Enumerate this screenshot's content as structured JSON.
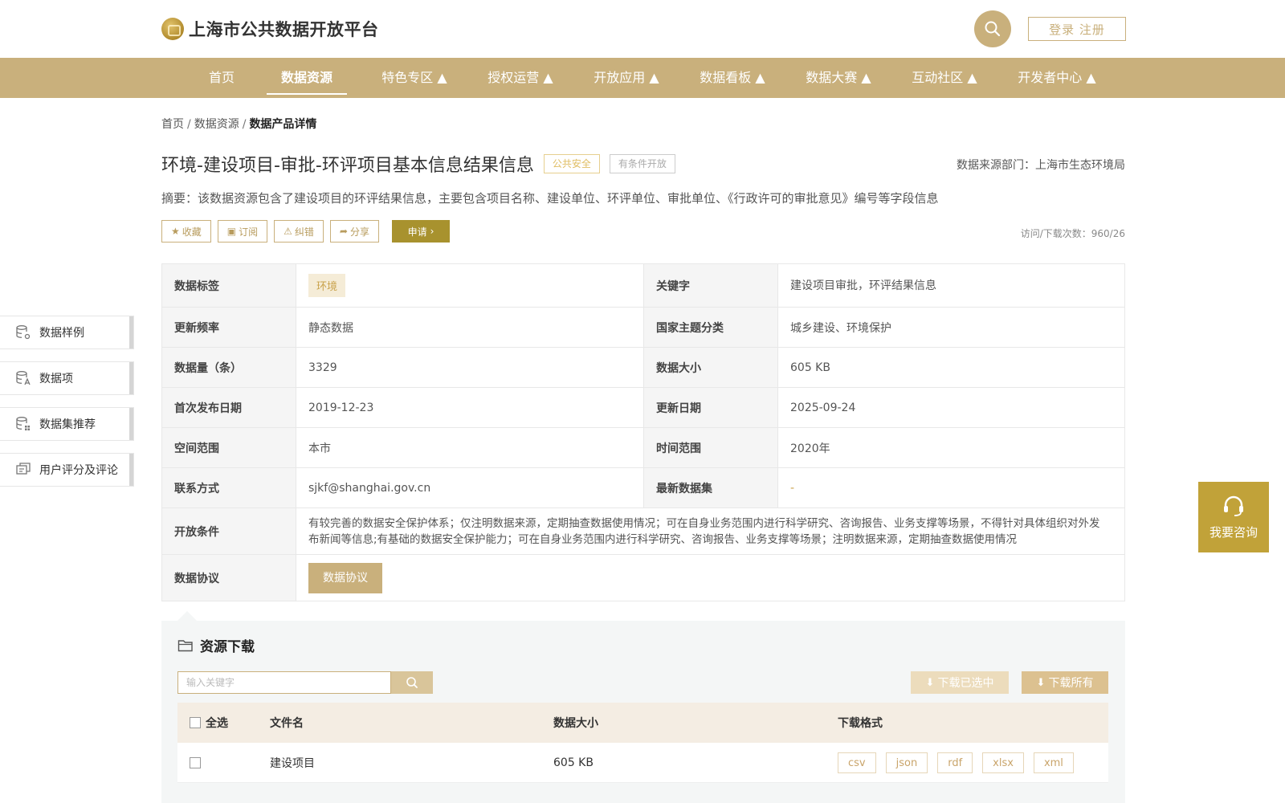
{
  "header": {
    "site_title": "上海市公共数据开放平台",
    "login_label": "登录 注册"
  },
  "nav": {
    "items": [
      {
        "label": "首页"
      },
      {
        "label": "数据资源"
      },
      {
        "label": "特色专区 ▲"
      },
      {
        "label": "授权运营 ▲"
      },
      {
        "label": "开放应用 ▲"
      },
      {
        "label": "数据看板 ▲"
      },
      {
        "label": "数据大赛 ▲"
      },
      {
        "label": "互动社区 ▲"
      },
      {
        "label": "开发者中心 ▲"
      }
    ],
    "active_index": 1
  },
  "breadcrumb": {
    "items": [
      "首页",
      "数据资源",
      "数据产品详情"
    ],
    "separator": "/"
  },
  "dataset": {
    "title": "环境-建设项目-审批-环评项目基本信息结果信息",
    "tag_security": "公共安全",
    "tag_open": "有条件开放",
    "source_dept": "数据来源部门：上海市生态环境局",
    "summary": "摘要：该数据资源包含了建设项目的环评结果信息，主要包含项目名称、建设单位、环评单位、审批单位、《行政许可的审批意见》编号等字段信息",
    "visit_download": "访问/下载次数：960/26"
  },
  "actions": {
    "favorite": "收藏",
    "subscribe": "订阅",
    "report": "纠错",
    "share": "分享",
    "apply": "申请"
  },
  "info": {
    "tag_label": "数据标签",
    "tag_value": "环境",
    "keyword_label": "关键字",
    "keyword_value": "建设项目审批，环评结果信息",
    "freq_label": "更新频率",
    "freq_value": "静态数据",
    "theme_label": "国家主题分类",
    "theme_value": "城乡建设、环境保护",
    "count_label": "数据量（条）",
    "count_value": "3329",
    "size_label": "数据大小",
    "size_value": "605 KB",
    "first_label": "首次发布日期",
    "first_value": "2019-12-23",
    "update_label": "更新日期",
    "update_value": "2025-09-24",
    "space_label": "空间范围",
    "space_value": "本市",
    "time_label": "时间范围",
    "time_value": "2020年",
    "contact_label": "联系方式",
    "contact_value": "sjkf@shanghai.gov.cn",
    "latest_label": "最新数据集",
    "latest_value": "-",
    "cond_label": "开放条件",
    "cond_value": "有较完善的数据安全保护体系；仅注明数据来源，定期抽查数据使用情况；可在自身业务范围内进行科学研究、咨询报告、业务支撑等场景，不得针对具体组织对外发布新闻等信息;有基础的数据安全保护能力；可在自身业务范围内进行科学研究、咨询报告、业务支撑等场景；注明数据来源，定期抽查数据使用情况",
    "protocol_label": "数据协议",
    "protocol_btn": "数据协议"
  },
  "sidebar": {
    "items": [
      {
        "label": "数据样例",
        "icon": "database-settings-icon"
      },
      {
        "label": "数据项",
        "icon": "database-text-icon"
      },
      {
        "label": "数据集推荐",
        "icon": "database-grid-icon"
      },
      {
        "label": "用户评分及评论",
        "icon": "comment-icon"
      }
    ]
  },
  "consult": {
    "label": "我要咨询"
  },
  "resources": {
    "title": "资源下载",
    "search_placeholder": "输入关键字",
    "download_selected": "下载已选中",
    "download_all": "下载所有",
    "columns": {
      "select_all": "全选",
      "filename": "文件名",
      "size": "数据大小",
      "formats": "下载格式"
    },
    "rows": [
      {
        "filename": "建设项目",
        "size": "605 KB",
        "formats": [
          "csv",
          "json",
          "rdf",
          "xlsx",
          "xml"
        ]
      }
    ]
  },
  "colors": {
    "brand": "#c9b07c",
    "apply": "#a8922e",
    "consult": "#c1a239"
  }
}
